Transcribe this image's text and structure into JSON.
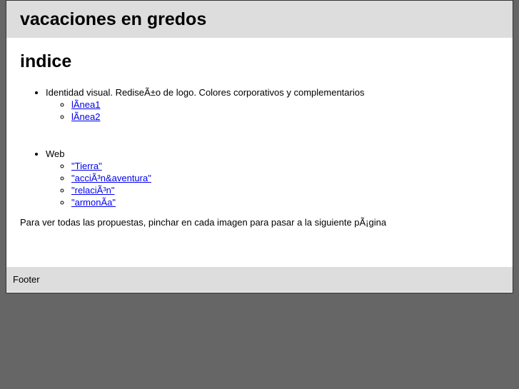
{
  "header": {
    "title": "vacaciones en gredos"
  },
  "content": {
    "heading": "indice",
    "sections": [
      {
        "label": "Identidad visual. RediseÃ±o de logo. Colores corporativos y complementarios",
        "links": [
          "lÃnea1",
          "lÃnea2"
        ]
      },
      {
        "label": "Web",
        "links": [
          "\"Tierra\"",
          "\"acciÃ³n&aventura\"",
          "\"relaciÃ³n\"",
          "\"armonÃa\""
        ]
      }
    ],
    "note": "Para ver todas las propuestas, pinchar en cada imagen para pasar a la siguiente pÃ¡gina"
  },
  "footer": {
    "text": "Footer"
  }
}
